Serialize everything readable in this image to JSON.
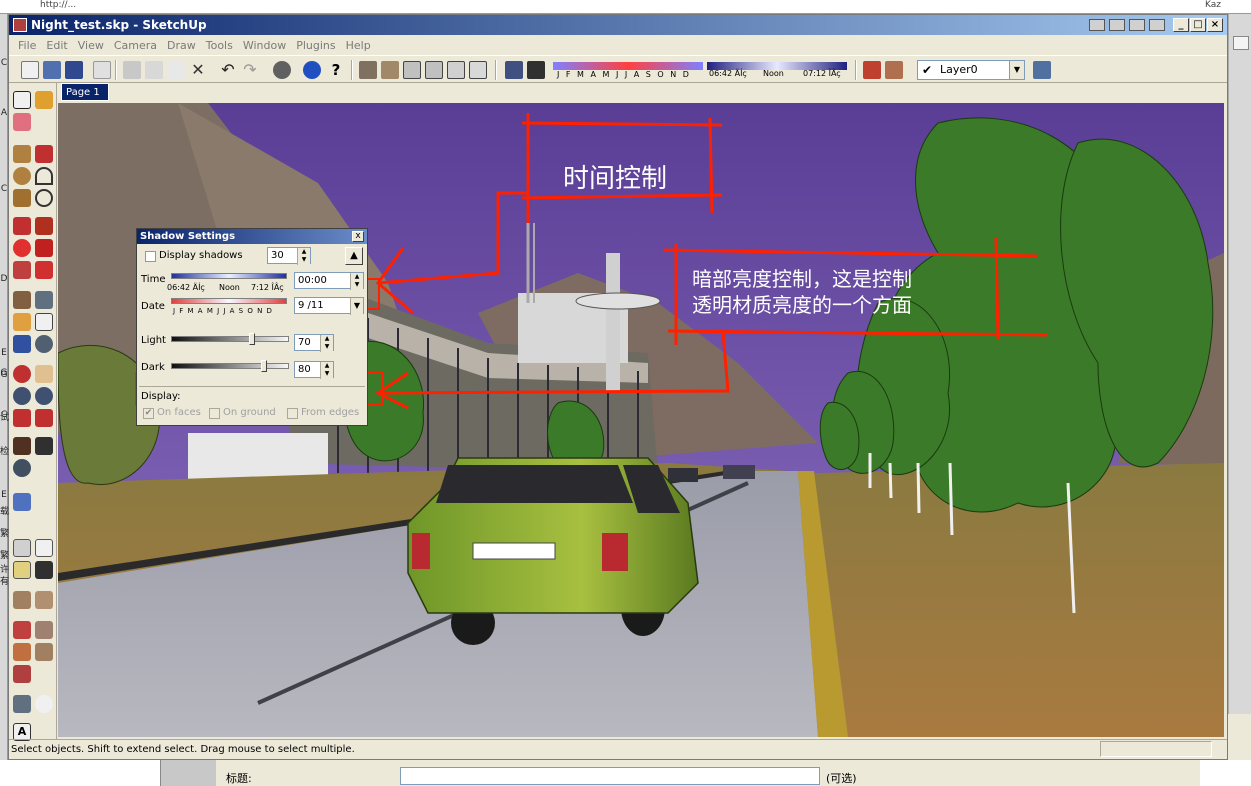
{
  "browser": {
    "url_fragment": "http://...",
    "corner_text": "Kaz"
  },
  "left_strip_chars": [
    "C",
    "A",
    "C",
    "D",
    "E",
    "G",
    "C",
    "E",
    "G",
    "试",
    "检",
    "载",
    "繁",
    "繁",
    "许",
    "有"
  ],
  "window": {
    "title": "Night_test.skp - SketchUp",
    "controls": [
      "_",
      "□",
      "×"
    ]
  },
  "menu": [
    "File",
    "Edit",
    "View",
    "Camera",
    "Draw",
    "Tools",
    "Window",
    "Plugins",
    "Help"
  ],
  "toolbar": {
    "shadow_months": "J F M A M J J A S O N D",
    "shadow_time_start": "06:42 ÄÍç",
    "shadow_time_noon": "Noon",
    "shadow_time_end": "07:12 ÎÂç",
    "layer": "Layer0"
  },
  "page_tab": "Page 1",
  "status": "Select objects. Shift to extend select. Drag mouse to select multiple.",
  "shadow_settings": {
    "title": "Shadow Settings",
    "close": "x",
    "display_shadows_label": "Display shadows",
    "display_shadows_checked": false,
    "utc_value": "30",
    "time_label": "Time",
    "time_value": "00:00",
    "time_start": "06:42 ÄÍç",
    "time_noon": "Noon",
    "time_end": "7:12 ÎÂç",
    "date_label": "Date",
    "date_months": "J F M A M J J A S O N D",
    "date_value": "9 /11",
    "light_label": "Light",
    "light_value": "70",
    "light_level": 0.7,
    "dark_label": "Dark",
    "dark_value": "80",
    "dark_level": 0.8,
    "display_label": "Display:",
    "on_faces_label": "On faces",
    "on_faces_checked": true,
    "on_ground_label": "On ground",
    "from_edges_label": "From edges"
  },
  "annotations": {
    "time_control": "时间控制",
    "dark_control_line1": "暗部亮度控制，这是控制",
    "dark_control_line2": "透明材质亮度的一个方面"
  },
  "form": {
    "label": "标题:",
    "hint": "(可选)"
  },
  "colors": {
    "title_bar": "#0a246a",
    "annotation_red": "#ff2000",
    "sky": "#6d4fa0",
    "car": "#8fb03a"
  }
}
